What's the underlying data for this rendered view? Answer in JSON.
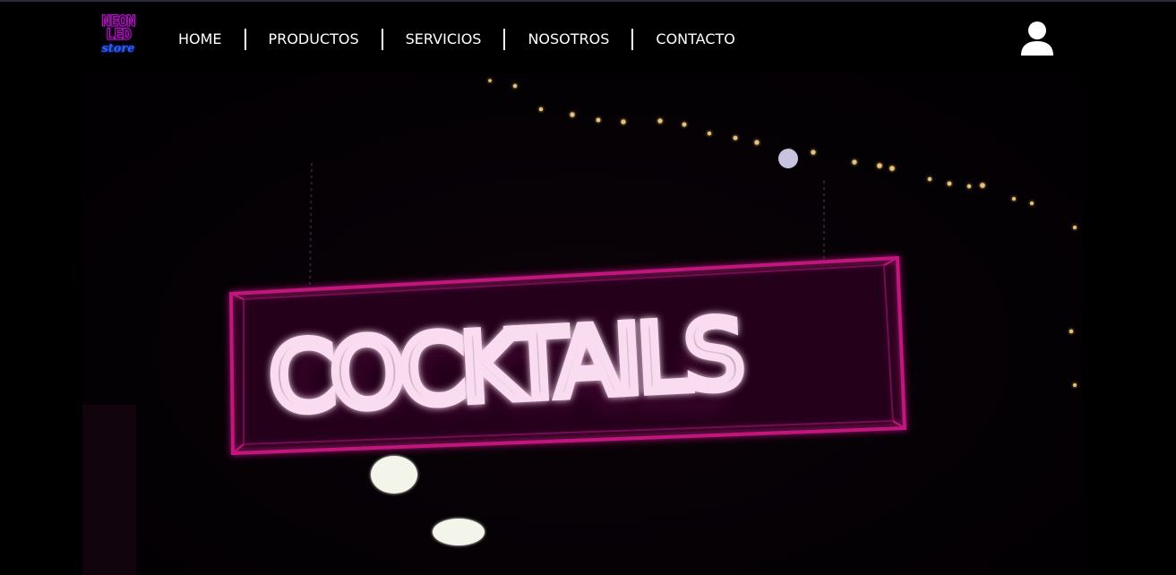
{
  "brand": {
    "logo_line1": "NEON",
    "logo_line2": "LED",
    "logo_line3": "store",
    "neon_color": "#b317c8",
    "store_color": "#2e5bff"
  },
  "nav": {
    "items": [
      {
        "label": "HOME"
      },
      {
        "label": "PRODUCTOS"
      },
      {
        "label": "SERVICIOS"
      },
      {
        "label": "NOSOTROS"
      },
      {
        "label": "CONTACTO"
      }
    ]
  },
  "header": {
    "user_icon": "user-icon"
  },
  "hero": {
    "image_subject": "neon sign",
    "sign_text": "COCKTAILS",
    "neon_color": "#c2167e",
    "tube_color": "#fbe6f5"
  }
}
